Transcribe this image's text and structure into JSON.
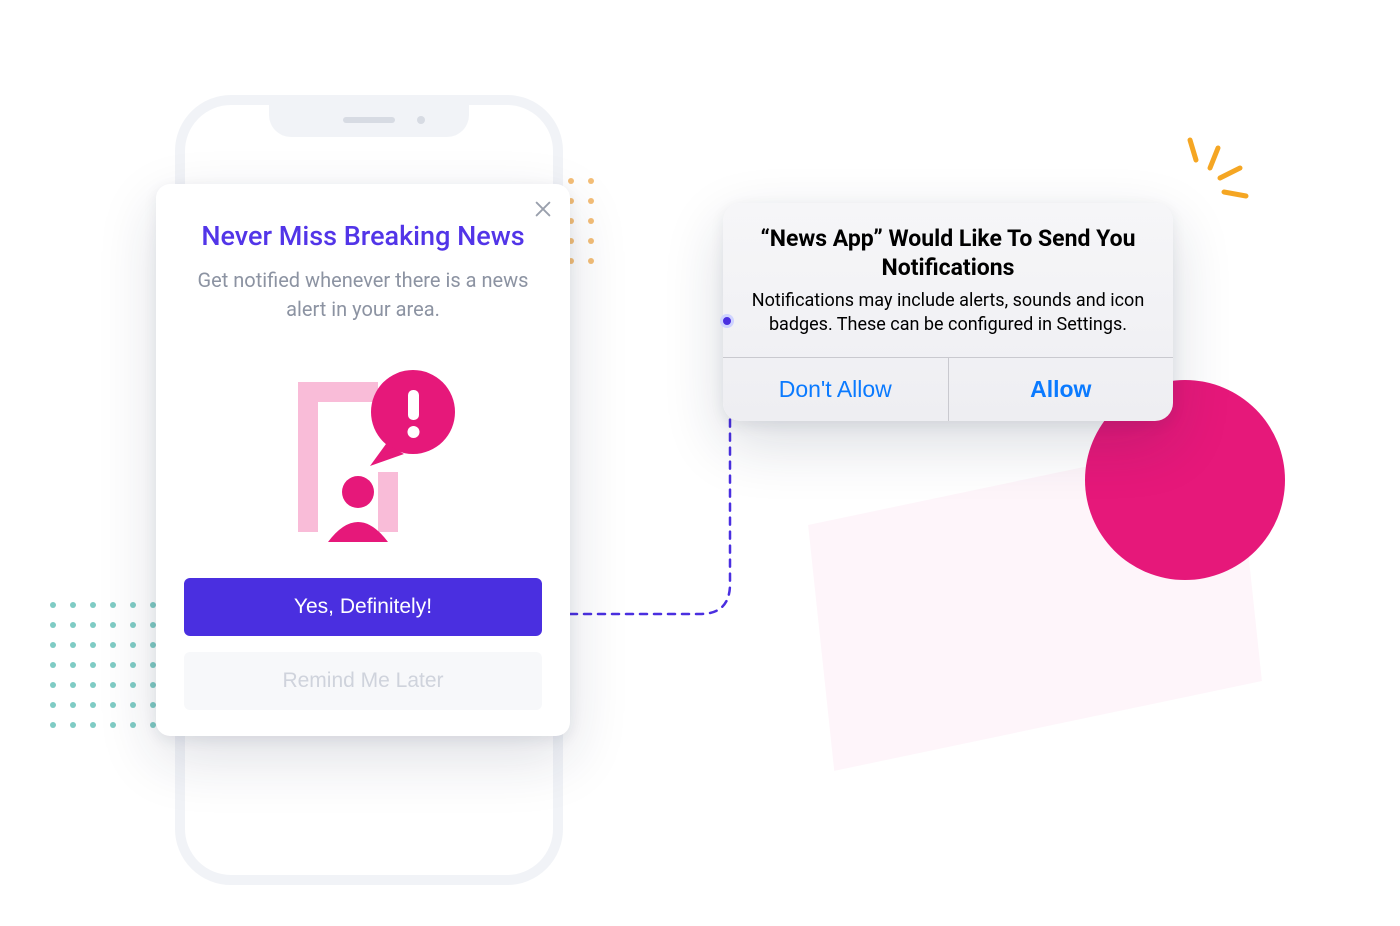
{
  "modal": {
    "title": "Never Miss Breaking News",
    "subtitle": "Get notified whenever there is a news alert in your area.",
    "primary_label": "Yes, Definitely!",
    "secondary_label": "Remind Me Later"
  },
  "system_alert": {
    "title": "“News App” Would Like To Send You Notifications",
    "body": "Notifications may include alerts, sounds and icon badges. These can be configured in Settings.",
    "deny_label": "Don't Allow",
    "allow_label": "Allow"
  },
  "colors": {
    "brand_purple": "#4a2fe0",
    "brand_pink": "#e6187a",
    "ios_blue": "#0a7aff",
    "accent_orange": "#f5a623"
  }
}
